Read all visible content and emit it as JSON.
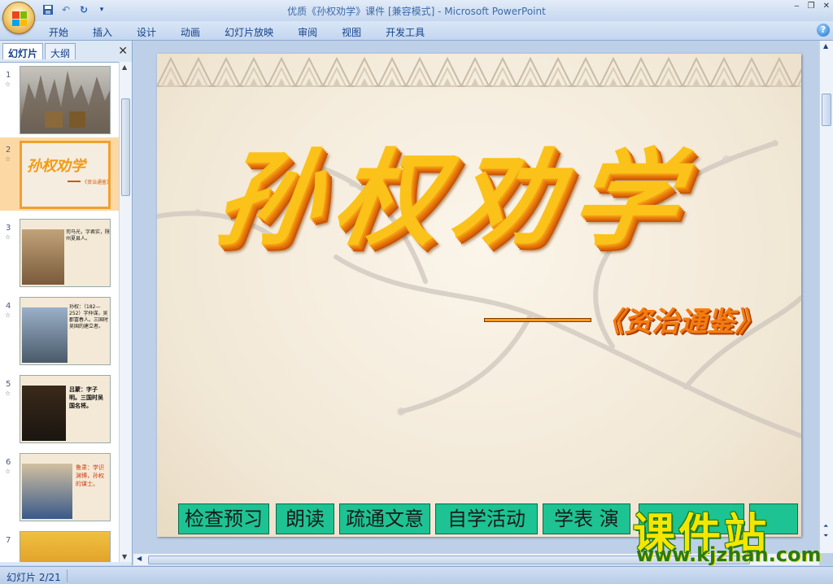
{
  "window": {
    "title": "优质《孙权劝学》课件 [兼容模式] - Microsoft PowerPoint"
  },
  "quick_access": [
    "save-icon",
    "undo-icon",
    "redo-icon",
    "customize-icon"
  ],
  "ribbon": {
    "tabs": [
      "开始",
      "插入",
      "设计",
      "动画",
      "幻灯片放映",
      "审阅",
      "视图",
      "开发工具"
    ]
  },
  "left_panel": {
    "tabs": [
      "幻灯片",
      "大纲"
    ],
    "slides": [
      {
        "num": "1",
        "desc": "stone forest photo"
      },
      {
        "num": "2",
        "desc": "title slide"
      },
      {
        "num": "3",
        "text": "司马光，字君实，陕州夏县人。"
      },
      {
        "num": "4",
        "text": "孙权：（182—252）字仲谋，吴郡富春人。三国时吴国的建立者。"
      },
      {
        "num": "5",
        "text": "吕蒙：字子明。三国时吴国名将。"
      },
      {
        "num": "6",
        "text": "鲁肃：学识渊博，孙权的谋士。"
      },
      {
        "num": "7",
        "text": ""
      }
    ],
    "selected_index": 1
  },
  "slide": {
    "title": "孙权劝学",
    "source": "《资治通鉴》",
    "nav_buttons": [
      "检查预习",
      "朗读",
      "疏通文意",
      "自学活动",
      "学表 演"
    ]
  },
  "watermark": {
    "top": "课件站",
    "bottom": "www.kjzhan.com"
  },
  "status": {
    "slide_position": "幻灯片 2/21"
  },
  "colors": {
    "title_fill": "#fbc21a",
    "title_shadow": "#de6a08",
    "source_fill": "#f47c10",
    "nav_button_bg": "#1dc392",
    "selected_thumb": "#f0a030"
  }
}
